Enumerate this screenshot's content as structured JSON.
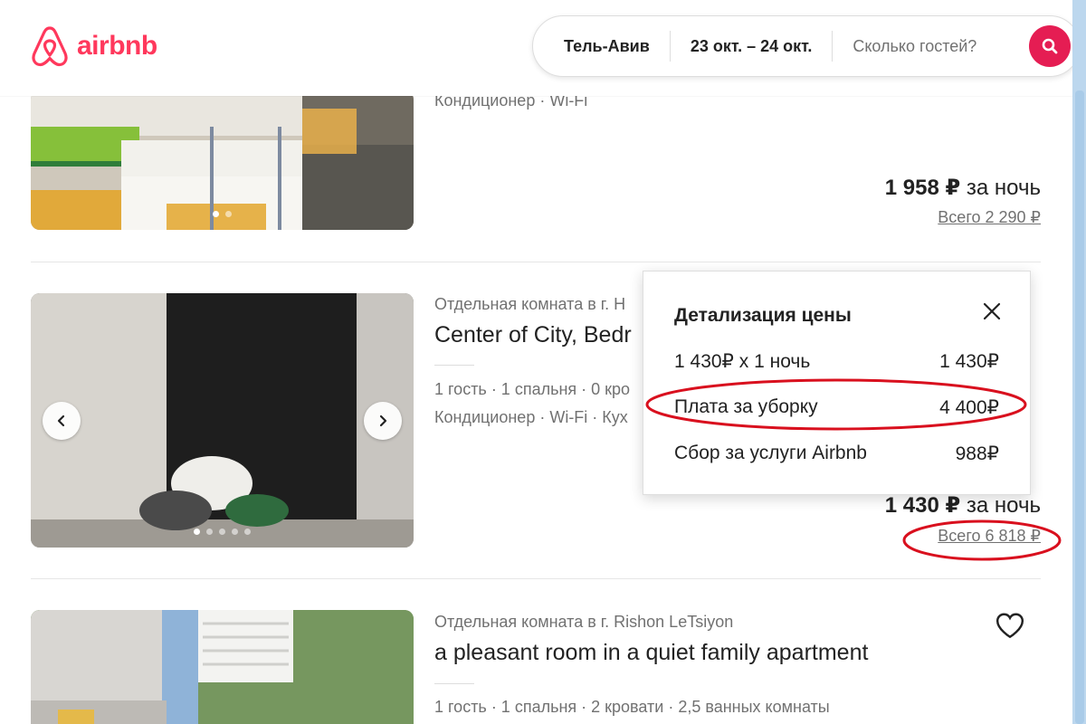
{
  "header": {
    "logo_text": "airbnb",
    "search": {
      "location": "Тель-Авив",
      "dates": "23 окт. – 24 окт.",
      "guests": "Сколько гостей?"
    }
  },
  "listings": [
    {
      "amenities": "Кондиционер · Wi-Fi",
      "price": "1 958 ₽",
      "price_unit": " за ночь",
      "total": "Всего 2 290 ₽"
    },
    {
      "type": "Отдельная комната в г. Н",
      "title": "Center of City, Bedr",
      "details": "1 гость · 1 спальня · 0 кро",
      "amenities": "Кондиционер · Wi-Fi · Кух",
      "price": "1 430 ₽",
      "price_unit": " за ночь",
      "total": "Всего 6 818 ₽"
    },
    {
      "type": "Отдельная комната в г. Rishon LeTsiyon",
      "title": "a pleasant room in a quiet family apartment",
      "details": "1 гость · 1 спальня · 2 кровати · 2,5 ванных комнаты"
    }
  ],
  "price_popup": {
    "title": "Детализация цены",
    "rows": [
      {
        "label": "1 430₽ x 1 ночь",
        "value": "1 430₽"
      },
      {
        "label": "Плата за уборку",
        "value": "4 400₽"
      },
      {
        "label": "Сбор за услуги Airbnb",
        "value": "988₽"
      }
    ]
  },
  "colors": {
    "brand": "#FF385C",
    "search_button": "#E51D53",
    "annotation": "#d9101e"
  },
  "icons": [
    "airbnb-logo-icon",
    "search-icon",
    "heart-icon",
    "close-icon",
    "chevron-left-icon",
    "chevron-right-icon"
  ]
}
